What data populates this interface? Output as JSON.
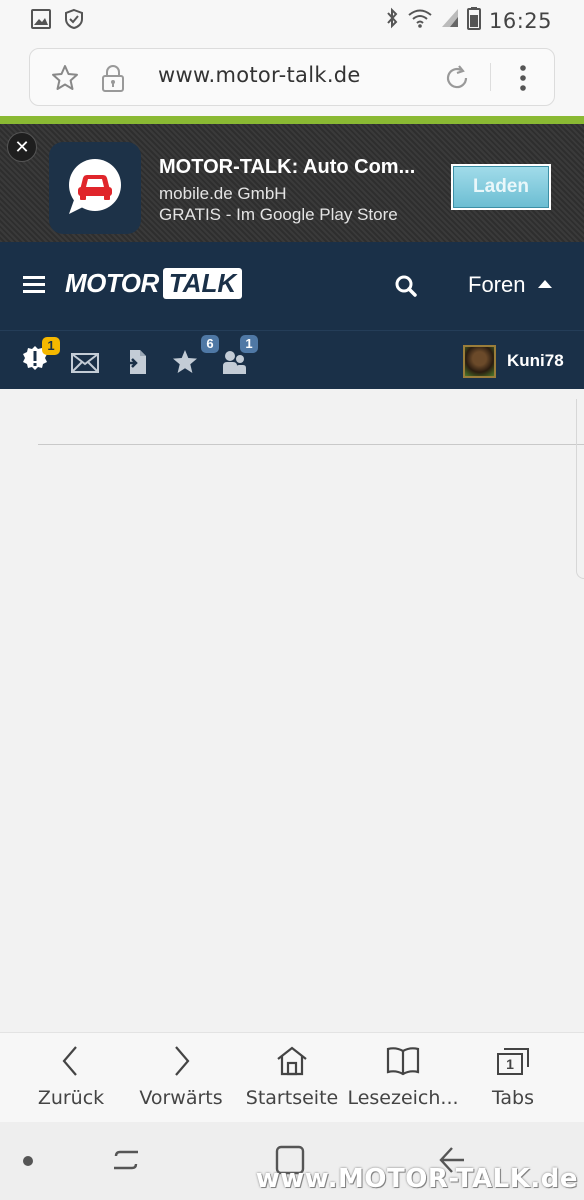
{
  "status_bar": {
    "time": "16:25",
    "icons": [
      "image-icon",
      "shield-check-icon",
      "bluetooth-icon",
      "wifi-icon",
      "signal-icon",
      "battery-icon"
    ]
  },
  "browser": {
    "url": "www.motor-talk.de"
  },
  "app_banner": {
    "title": "MOTOR-TALK: Auto Com...",
    "publisher": "mobile.de GmbH",
    "store_text": "GRATIS - Im Google Play Store",
    "install_label": "Laden",
    "close_glyph": "✕"
  },
  "site_nav": {
    "logo_motor": "MOTOR",
    "logo_talk": "TALK",
    "forums_label": "Foren"
  },
  "user_bar": {
    "notifications_count": "1",
    "favorites_count": "6",
    "friends_count": "1",
    "username": "Kuni78"
  },
  "bottom_bar": {
    "back_label": "Zurück",
    "forward_label": "Vorwärts",
    "home_label": "Startseite",
    "bookmarks_label": "Lesezeich...",
    "tabs_label": "Tabs",
    "tabs_count": "1"
  },
  "watermark": "www.MOTOR-TALK.de",
  "colors": {
    "nav_bg": "#1a3048",
    "accent_green": "#8ab933",
    "badge_yellow": "#f5b800",
    "badge_blue": "#4f78a5"
  }
}
